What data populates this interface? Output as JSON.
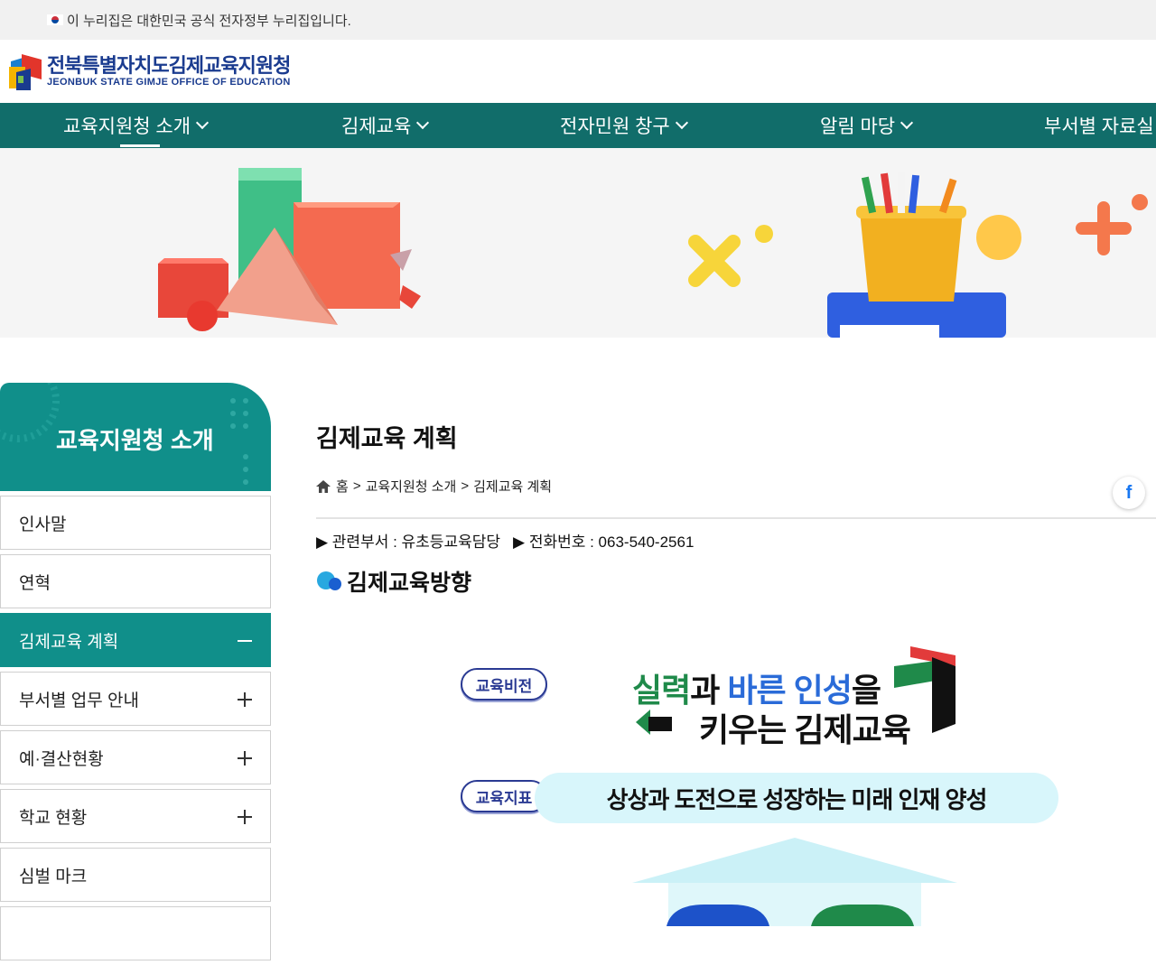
{
  "gov_notice": {
    "text": "이 누리집은 대한민국 공식 전자정부 누리집입니다."
  },
  "header": {
    "logo_ko": "전북특별자치도김제교육지원청",
    "logo_en": "JEONBUK STATE GIMJE OFFICE OF EDUCATION"
  },
  "gnb": {
    "items": [
      {
        "label": "교육지원청 소개",
        "active": true
      },
      {
        "label": "김제교육"
      },
      {
        "label": "전자민원 창구"
      },
      {
        "label": "알림 마당"
      },
      {
        "label": "부서별 자료실"
      }
    ]
  },
  "sidebar": {
    "title": "교육지원청 소개",
    "items": [
      {
        "label": "인사말",
        "toggle": "none"
      },
      {
        "label": "연혁",
        "toggle": "none"
      },
      {
        "label": "김제교육 계획",
        "toggle": "minus",
        "active": true
      },
      {
        "label": "부서별 업무 안내",
        "toggle": "plus"
      },
      {
        "label": "예·결산현황",
        "toggle": "plus"
      },
      {
        "label": "학교 현황",
        "toggle": "plus"
      },
      {
        "label": "심벌 마크",
        "toggle": "none"
      }
    ]
  },
  "content": {
    "page_title": "김제교육 계획",
    "breadcrumb": {
      "home": "홈",
      "sep": ">",
      "level1": "교육지원청 소개",
      "level2": "김제교육 계획"
    },
    "share_icon": "f",
    "dept_label": "▶ 관련부서 : 유초등교육담당",
    "phone_label": "▶ 전화번호 : 063-540-2561",
    "section_title": "김제교육방향"
  },
  "vision": {
    "vision_pill": "교육비전",
    "goal_pill": "교육지표",
    "vision_line1_a": "실력",
    "vision_line1_b": "과 ",
    "vision_line1_c": "바른 인성",
    "vision_line1_d": "을",
    "vision_line2": "키우는 김제교육",
    "goal_text": "상상과 도전으로 성장하는 미래 인재 양성"
  },
  "colors": {
    "gnb_bg": "#116d6a",
    "side_active": "#108f8a",
    "brand_navy": "#1a3b8f",
    "vision_green": "#1f8a4a",
    "vision_blue": "#2a6bd8"
  }
}
